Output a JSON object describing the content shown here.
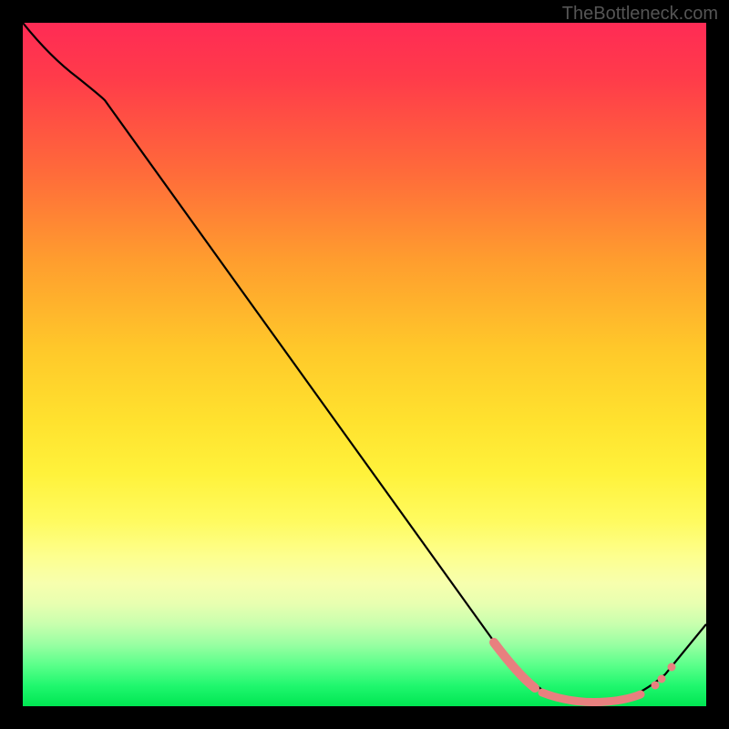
{
  "watermark": "TheBottleneck.com",
  "chart_data": {
    "type": "line",
    "title": "",
    "xlabel": "",
    "ylabel": "",
    "xlim": [
      0,
      100
    ],
    "ylim": [
      0,
      100
    ],
    "series": [
      {
        "name": "curve",
        "x": [
          0,
          4,
          8,
          12,
          70,
          74,
          78,
          82,
          86,
          90,
          94,
          100
        ],
        "y": [
          100,
          97,
          93.5,
          89,
          8,
          4,
          1.5,
          0.5,
          0.5,
          1.5,
          4,
          12
        ]
      }
    ],
    "highlight_segments": [
      {
        "x": [
          69,
          76
        ],
        "color": "#e87a7a",
        "width": 6
      },
      {
        "x": [
          77,
          90
        ],
        "color": "#e87a7a",
        "width": 5
      },
      {
        "x": [
          91,
          94.5
        ],
        "color": "#e87a7a",
        "width": 5,
        "dots": true
      }
    ],
    "background_gradient": {
      "stops": [
        {
          "pct": 0,
          "color": "#ff2b55"
        },
        {
          "pct": 50,
          "color": "#ffdc30"
        },
        {
          "pct": 80,
          "color": "#fbff90"
        },
        {
          "pct": 100,
          "color": "#00e652"
        }
      ]
    }
  }
}
